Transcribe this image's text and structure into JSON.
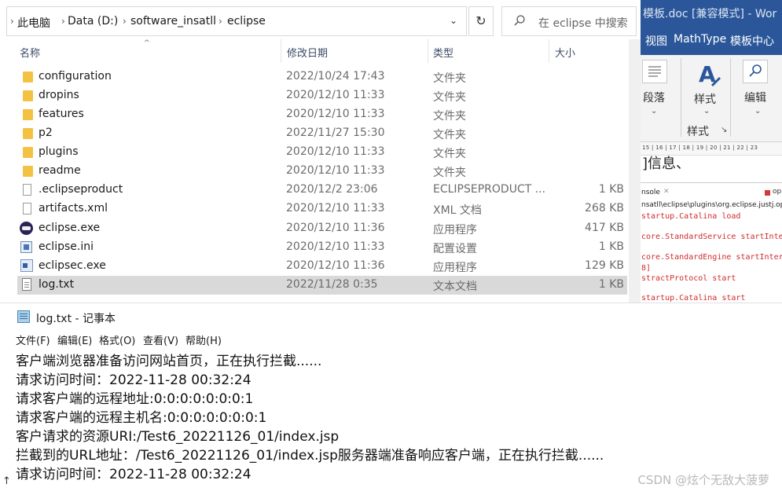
{
  "explorer": {
    "breadcrumb": [
      "此电脑",
      "Data (D:)",
      "software_insatll",
      "eclipse"
    ],
    "search_placeholder": "在 eclipse 中搜索",
    "columns": {
      "name": "名称",
      "date": "修改日期",
      "type": "类型",
      "size": "大小"
    },
    "files": [
      {
        "name": "configuration",
        "date": "2022/10/24 17:43",
        "type": "文件夹",
        "size": "",
        "icon": "folder-icon"
      },
      {
        "name": "dropins",
        "date": "2020/12/10 11:33",
        "type": "文件夹",
        "size": "",
        "icon": "folder-icon"
      },
      {
        "name": "features",
        "date": "2020/12/10 11:33",
        "type": "文件夹",
        "size": "",
        "icon": "folder-icon"
      },
      {
        "name": "p2",
        "date": "2022/11/27 15:30",
        "type": "文件夹",
        "size": "",
        "icon": "folder-icon"
      },
      {
        "name": "plugins",
        "date": "2020/12/10 11:33",
        "type": "文件夹",
        "size": "",
        "icon": "folder-icon"
      },
      {
        "name": "readme",
        "date": "2020/12/10 11:33",
        "type": "文件夹",
        "size": "",
        "icon": "folder-icon"
      },
      {
        "name": ".eclipseproduct",
        "date": "2020/12/2 23:06",
        "type": "ECLIPSEPRODUCT ...",
        "size": "1 KB",
        "icon": "file-icon"
      },
      {
        "name": "artifacts.xml",
        "date": "2020/12/10 11:33",
        "type": "XML 文档",
        "size": "268 KB",
        "icon": "file-icon"
      },
      {
        "name": "eclipse.exe",
        "date": "2020/12/10 11:36",
        "type": "应用程序",
        "size": "417 KB",
        "icon": "eclipse-app-icon"
      },
      {
        "name": "eclipse.ini",
        "date": "2020/12/10 11:33",
        "type": "配置设置",
        "size": "1 KB",
        "icon": "settings-file-icon"
      },
      {
        "name": "eclipsec.exe",
        "date": "2020/12/10 11:36",
        "type": "应用程序",
        "size": "129 KB",
        "icon": "console-app-icon"
      },
      {
        "name": "log.txt",
        "date": "2022/11/28 0:35",
        "type": "文本文档",
        "size": "1 KB",
        "icon": "text-file-icon",
        "selected": true
      }
    ]
  },
  "word": {
    "title": "模板.doc [兼容模式] - Wor",
    "tabs": [
      "视图",
      "MathType",
      "模板中心"
    ],
    "ribbon": {
      "paragraph": "段落",
      "styles": "样式",
      "edit": "编辑",
      "styles_group": "样式"
    },
    "ruler": "15 | 16 | 17 | 18 | 19 | 20 | 21 | 22 | 23",
    "doc_fragment": "]信息、",
    "console": {
      "tab": "nsole",
      "op": "op",
      "path": "nsatll\\eclipse\\plugins\\org.eclipse.justj.op",
      "lines": [
        "startup.Catalina load",
        "core.StandardService startInter",
        "core.StandardEngine startIntern",
        "8]",
        "stractProtocol start",
        "startup.Catalina start"
      ]
    }
  },
  "notepad": {
    "title": "log.txt - 记事本",
    "menu": [
      "文件(F)",
      "编辑(E)",
      "格式(O)",
      "查看(V)",
      "帮助(H)"
    ],
    "lines": [
      "客户端浏览器准备访问网站首页，正在执行拦截......",
      "请求访问时间：2022-11-28 00:32:24",
      "请求客户端的远程地址:0:0:0:0:0:0:0:1",
      "请求客户端的远程主机名:0:0:0:0:0:0:0:1",
      "客户请求的资源URI:/Test6_20221126_01/index.jsp",
      "拦截到的URL地址：/Test6_20221126_01/index.jsp服务器端准备响应客户端，正在执行拦截......",
      "请求访问时间：2022-11-28 00:32:24"
    ],
    "watermark": "CSDN @炫个无敌大菠萝"
  }
}
